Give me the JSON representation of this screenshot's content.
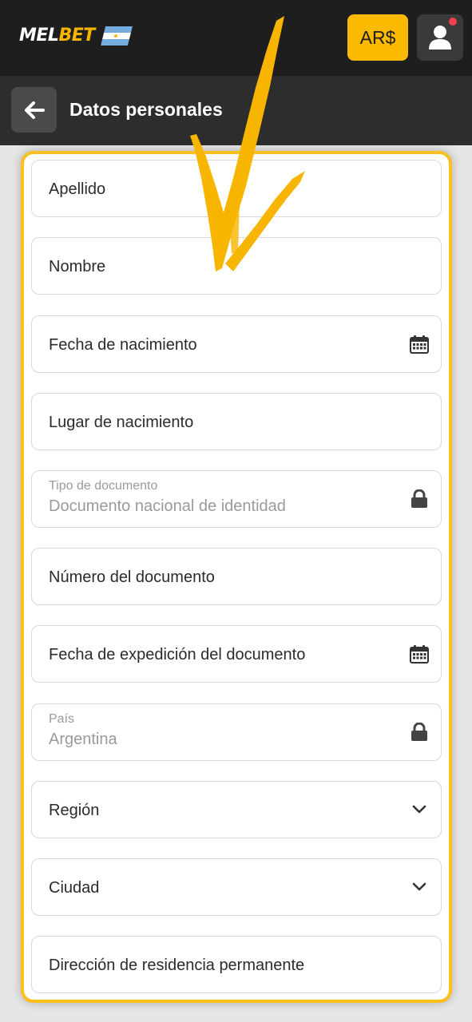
{
  "header": {
    "logo_prefix": "MEL",
    "logo_suffix": "BET",
    "currency_label": "AR$"
  },
  "subheader": {
    "title": "Datos personales"
  },
  "form": {
    "fields": [
      {
        "label": "Apellido"
      },
      {
        "label": "Nombre"
      },
      {
        "label": "Fecha de nacimiento",
        "icon": "calendar-icon"
      },
      {
        "label": "Lugar de nacimiento"
      },
      {
        "label": "Tipo de documento",
        "value": "Documento nacional de identidad",
        "icon": "lock-icon"
      },
      {
        "label": "Número del documento"
      },
      {
        "label": "Fecha de expedición del documento",
        "icon": "calendar-icon"
      },
      {
        "label": "País",
        "value": "Argentina",
        "icon": "lock-icon"
      },
      {
        "label": "Región",
        "icon": "chevron-down-icon"
      },
      {
        "label": "Ciudad",
        "icon": "chevron-down-icon"
      },
      {
        "label": "Dirección de residencia permanente"
      }
    ]
  },
  "colors": {
    "accent": "#fbb900",
    "panel_border": "#fbc01c",
    "topbar": "#1e1e1e",
    "subheader": "#2d2d2d",
    "notification": "#ef4050"
  }
}
